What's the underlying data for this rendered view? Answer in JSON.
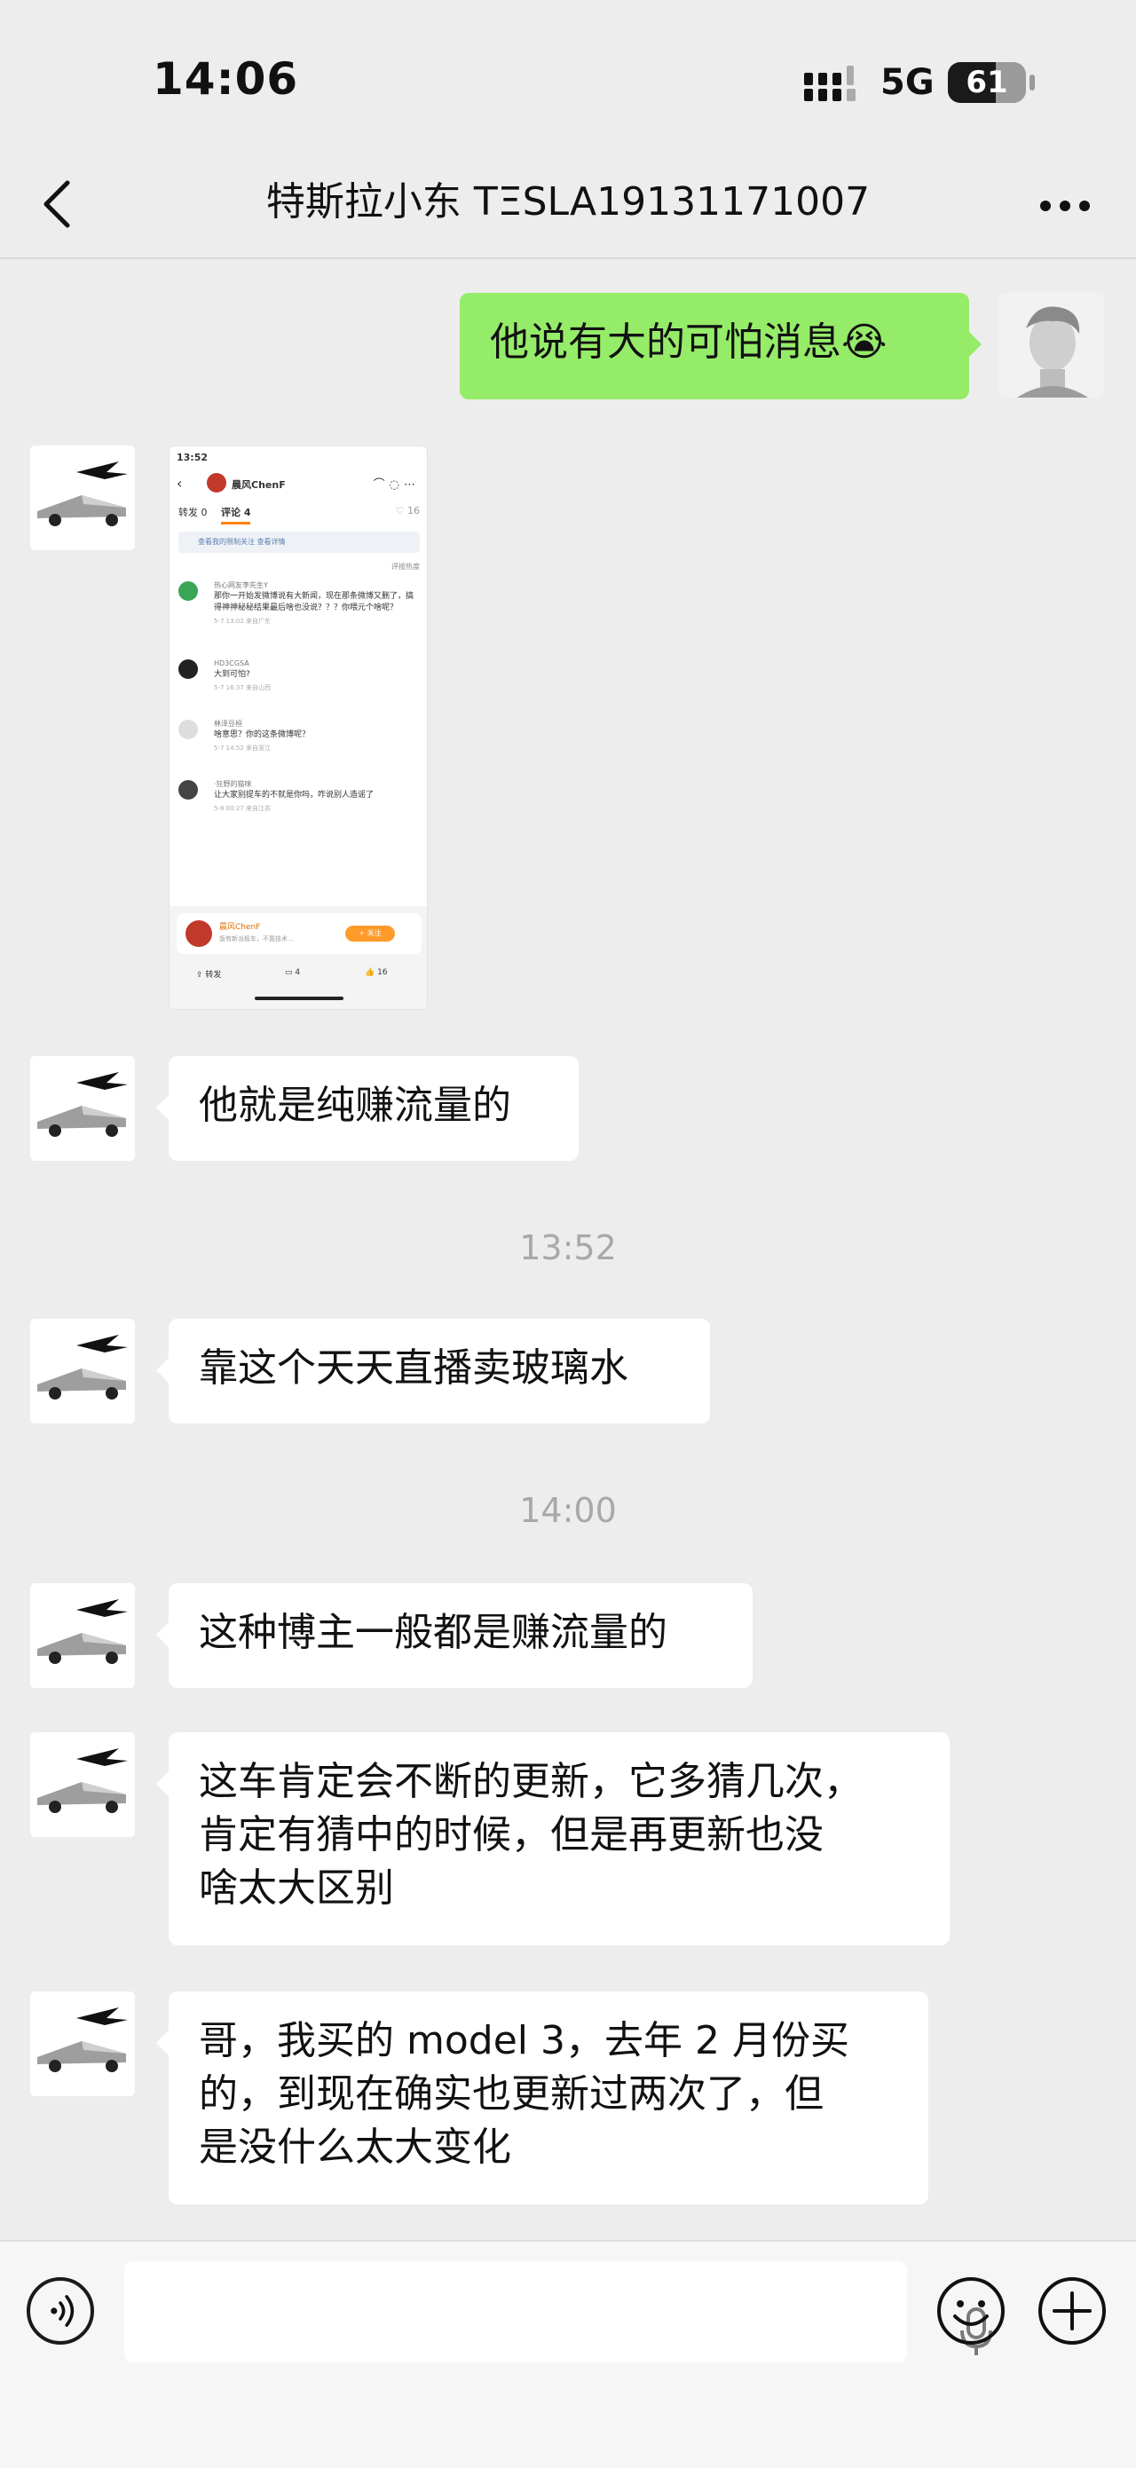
{
  "status_bar": {
    "time": "14:06",
    "network": "5G",
    "battery": "61",
    "battery_level": 0.61
  },
  "header": {
    "title": "特斯拉小东 TΞSLA19131171007",
    "back_icon": "chevron-left-icon",
    "more_icon": "more-horizontal-icon"
  },
  "messages": [
    {
      "side": "out",
      "type": "text",
      "text": "他说有大的可怕消息😭"
    },
    {
      "side": "in",
      "type": "image",
      "screenshot": {
        "time": "13:52",
        "author": "晨风ChenF",
        "tab_repost": "转发 0",
        "tab_comment": "评论 4",
        "like_count": "16",
        "notice": "查看我的限制关注 查看详情",
        "sort_label": "评按热度",
        "comments": [
          {
            "name": "热心网友李先生Y",
            "text": "那你一开始发微博说有大新闻，现在那条微博又删了，搞得神神秘秘结果最后啥也没说？？？你喂元个啥呢？",
            "meta": "5-7 13:02 来自广东",
            "color": "#3aa655"
          },
          {
            "name": "HD3CGSA",
            "text": "大到可怕?",
            "meta": "5-7 16:37 来自山西",
            "color": "#222222"
          },
          {
            "name": "林泽豆桓",
            "text": "啥意思？你的这条微博呢？",
            "meta": "5-7 14:52 来自浙江",
            "color": "#dddddd"
          },
          {
            "name": "·狂野的猫咪",
            "text": "让大家别提车的不就是你吗，咋说别人造谣了",
            "meta": "5-8 00:27 来自江苏",
            "color": "#444444"
          }
        ],
        "card_name": "晨风ChenF",
        "card_desc": "饭有新派极车，不靠技术...",
        "follow_label": "+ 关注",
        "action_repost": "转发",
        "action_comment": "4",
        "action_like": "16"
      }
    },
    {
      "side": "in",
      "type": "text",
      "text": "他就是纯赚流量的"
    },
    {
      "type": "time",
      "text": "13:52"
    },
    {
      "side": "in",
      "type": "text",
      "text": "靠这个天天直播卖玻璃水"
    },
    {
      "type": "time",
      "text": "14:00"
    },
    {
      "side": "in",
      "type": "text",
      "text": "这种博主一般都是赚流量的"
    },
    {
      "side": "in",
      "type": "text",
      "lines": [
        "这车肯定会不断的更新，它多猜几次，",
        "肯定有猜中的时候，但是再更新也没",
        "啥太大区别"
      ]
    },
    {
      "side": "in",
      "type": "text",
      "lines": [
        "哥，我买的 model 3，去年 2 月份买",
        "的，到现在确实也更新过两次了，但",
        "是没什么太大变化"
      ]
    }
  ],
  "input_bar": {
    "voice_icon": "voice-icon",
    "mic_icon": "microphone-icon",
    "emoji_icon": "emoji-icon",
    "plus_icon": "plus-icon"
  }
}
